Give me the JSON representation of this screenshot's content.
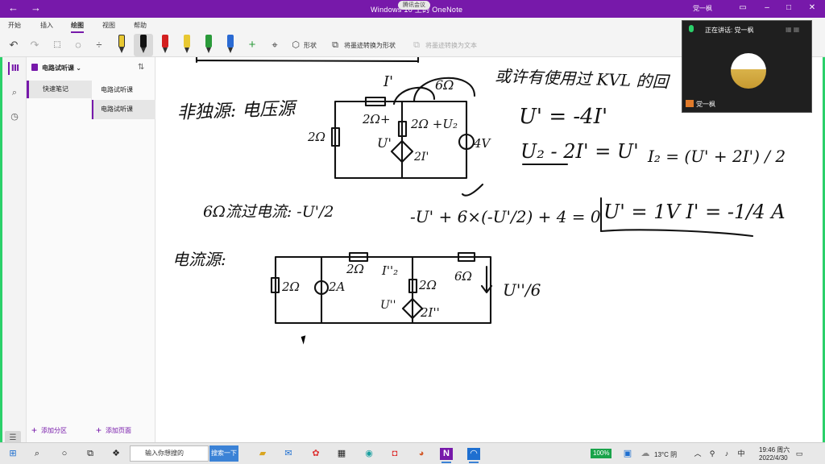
{
  "window": {
    "title": "Windows 10 上的 OneNote",
    "share_badge": "腾讯会议",
    "user": "党一枫",
    "back_icon": "←",
    "forward_icon": "→"
  },
  "menu": {
    "tabs": [
      "开始",
      "插入",
      "绘图",
      "视图",
      "帮助"
    ],
    "active": "绘图"
  },
  "toolbar": {
    "shapes_label": "形状",
    "ink_to_shape_label": "将墨迹转换为形状",
    "ink_to_text_label": "将墨迹转换为文本",
    "pens": [
      {
        "color": "#e8c832"
      },
      {
        "color": "#111111"
      },
      {
        "color": "#d32020"
      },
      {
        "color": "#e8c832"
      },
      {
        "color": "#2a9a3a"
      },
      {
        "color": "#2a6ad3"
      }
    ]
  },
  "notebook": {
    "name": "电路试听课",
    "sections": [
      "快速笔记"
    ],
    "pages": [
      "电路试听课",
      "电路试听课"
    ],
    "add_section": "添加分区",
    "add_page": "添加页面"
  },
  "video": {
    "speaking": "正在讲话: 党一枫",
    "participant": "党一枫"
  },
  "taskbar": {
    "search_placeholder": "输入你想搜的",
    "search_button": "搜索一下",
    "zoom": "100%",
    "weather": "13°C 阴",
    "time": "19:46 周六",
    "date": "2022/4/30"
  },
  "ink": {
    "heading_voltage": "非独源: 电压源",
    "heading_current": "电流源:",
    "note_kvl": "或许有使用过 KVL 的回",
    "eq1": "U' = -4I'",
    "eq2": "U₂ - 2I' = U'",
    "eq3": "I₂ = (U' + 2I') / 2",
    "current_6ohm": "6Ω流过电流: -U'/2",
    "kvl_eq": "-U' + 6×(-U'/2) + 4 = 0",
    "result": "U' = 1V   I' = -1/4 A",
    "ratio": "U''/6"
  }
}
